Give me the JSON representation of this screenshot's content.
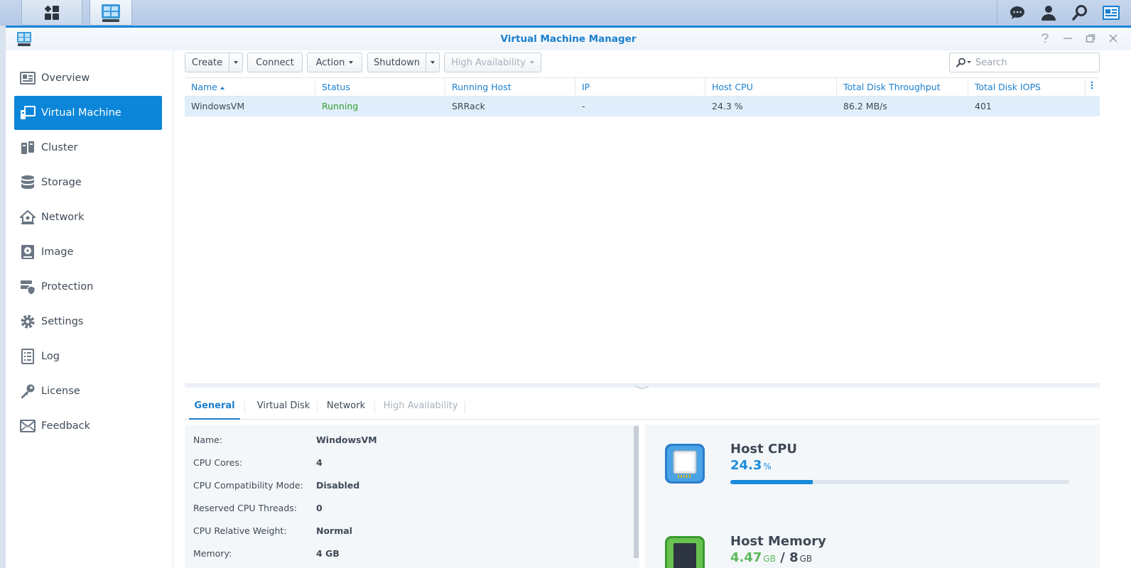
{
  "window": {
    "title": "Virtual Machine Manager"
  },
  "taskbar": {
    "buttons": [
      "main-menu",
      "virtual-machine-manager"
    ],
    "right_icons": [
      "chat-icon",
      "user-icon",
      "search-icon",
      "widgets-icon"
    ]
  },
  "sidebar": {
    "items": [
      {
        "label": "Overview",
        "icon": "overview-icon"
      },
      {
        "label": "Virtual Machine",
        "icon": "virtual-machine-icon",
        "active": true
      },
      {
        "label": "Cluster",
        "icon": "cluster-icon"
      },
      {
        "label": "Storage",
        "icon": "storage-icon"
      },
      {
        "label": "Network",
        "icon": "network-icon"
      },
      {
        "label": "Image",
        "icon": "image-icon"
      },
      {
        "label": "Protection",
        "icon": "protection-icon"
      },
      {
        "label": "Settings",
        "icon": "settings-icon"
      },
      {
        "label": "Log",
        "icon": "log-icon"
      },
      {
        "label": "License",
        "icon": "license-icon"
      },
      {
        "label": "Feedback",
        "icon": "feedback-icon"
      }
    ]
  },
  "toolbar": {
    "create": "Create",
    "connect": "Connect",
    "action": "Action",
    "shutdown": "Shutdown",
    "high_availability": "High Availability",
    "search_placeholder": "Search"
  },
  "table": {
    "columns": [
      "Name",
      "Status",
      "Running Host",
      "IP",
      "Host CPU",
      "Total Disk Throughput",
      "Total Disk IOPS"
    ],
    "rows": [
      {
        "name": "WindowsVM",
        "status": "Running",
        "running_host": "SRRack",
        "ip": "-",
        "host_cpu": "24.3 %",
        "throughput": "86.2 MB/s",
        "iops": "401"
      }
    ]
  },
  "tabs": [
    "General",
    "Virtual Disk",
    "Network",
    "High Availability"
  ],
  "general": [
    {
      "label": "Name:",
      "value": "WindowsVM"
    },
    {
      "label": "CPU Cores:",
      "value": "4"
    },
    {
      "label": "CPU Compatibility Mode:",
      "value": "Disabled"
    },
    {
      "label": "Reserved CPU Threads:",
      "value": "0"
    },
    {
      "label": "CPU Relative Weight:",
      "value": "Normal"
    },
    {
      "label": "Memory:",
      "value": "4 GB"
    }
  ],
  "stats": {
    "cpu": {
      "title": "Host CPU",
      "value": "24.3",
      "unit": "%",
      "fraction": 0.243
    },
    "memory": {
      "title": "Host Memory",
      "value": "4.47",
      "value_unit": "GB",
      "total": "8",
      "total_unit": "GB"
    }
  },
  "colors": {
    "accent": "#1a7fcf",
    "active_nav": "#0b86d9",
    "running": "#33a12c"
  }
}
